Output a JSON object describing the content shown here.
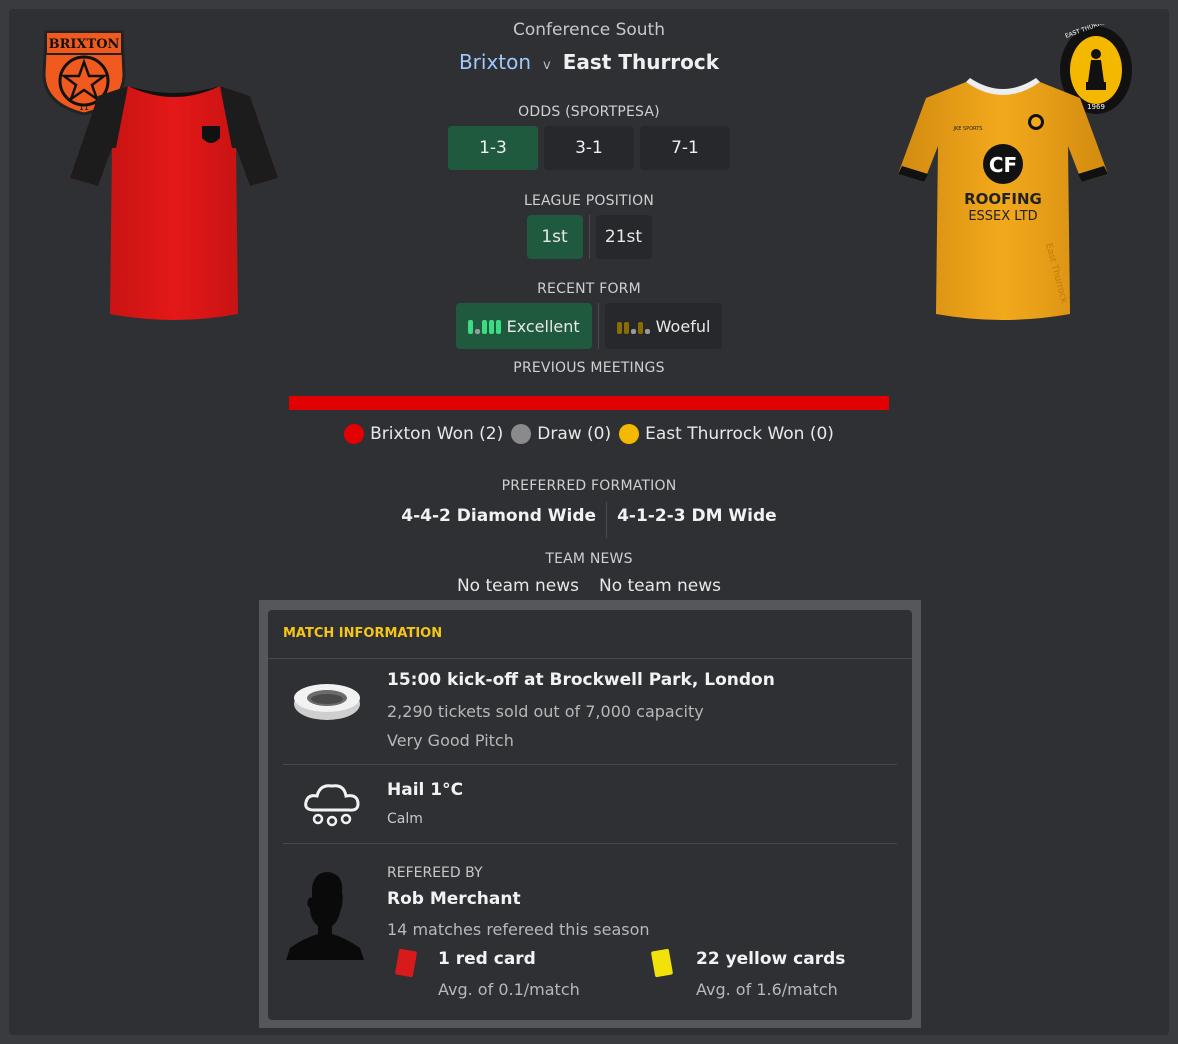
{
  "header": {
    "competition": "Conference South",
    "home_team": "Brixton",
    "versus": "v",
    "away_team": "East Thurrock"
  },
  "crests": {
    "home_text_top": "BRIXTON",
    "home_text_bottom": "11",
    "away_text": "EAST THURROCK UNITED FC",
    "away_year": "1969"
  },
  "kits": {
    "away_sponsor_line1": "CF",
    "away_sponsor_line2": "ROOFING",
    "away_sponsor_line3": "ESSEX LTD",
    "away_maker": "JKE SPORTS",
    "away_side_text": "East Thurrock"
  },
  "odds": {
    "title": "ODDS (SPORTPESA)",
    "values": [
      "1-3",
      "3-1",
      "7-1"
    ]
  },
  "league_position": {
    "title": "LEAGUE POSITION",
    "home": "1st",
    "away": "21st"
  },
  "recent_form": {
    "title": "RECENT FORM",
    "home": "Excellent",
    "away": "Woeful"
  },
  "previous_meetings": {
    "title": "PREVIOUS MEETINGS",
    "home_won": "Brixton Won (2)",
    "draw": "Draw (0)",
    "away_won": "East Thurrock Won (0)",
    "home_fraction": 1.0,
    "colors": {
      "home": "#e30000",
      "draw": "#8a8a8a",
      "away": "#f5b800"
    }
  },
  "formation": {
    "title": "PREFERRED FORMATION",
    "home": "4-4-2 Diamond Wide",
    "away": "4-1-2-3 DM Wide"
  },
  "team_news": {
    "title": "TEAM NEWS",
    "home": "No team news",
    "away": "No team news"
  },
  "match_info": {
    "title": "MATCH INFORMATION",
    "venue": "15:00 kick-off at Brockwell Park, London",
    "tickets": "2,290 tickets sold out of 7,000 capacity",
    "pitch": "Very Good Pitch",
    "weather": "Hail 1°C",
    "wind": "Calm",
    "referee_label": "REFEREED BY",
    "referee_name": "Rob Merchant",
    "referee_matches": "14 matches refereed this season",
    "red_cards": "1 red card",
    "red_avg": "Avg. of 0.1/match",
    "yellow_cards": "22 yellow cards",
    "yellow_avg": "Avg. of 1.6/match"
  },
  "colors": {
    "accent_green": "#1f5a3e",
    "title_yellow": "#f5c518",
    "home_link": "#9ec9ff"
  },
  "icons": [
    "brixton-crest-icon",
    "east-thurrock-crest-icon",
    "stadium-icon",
    "hail-cloud-icon",
    "referee-silhouette-icon",
    "red-card-icon",
    "yellow-card-icon",
    "form-bars-icon"
  ]
}
